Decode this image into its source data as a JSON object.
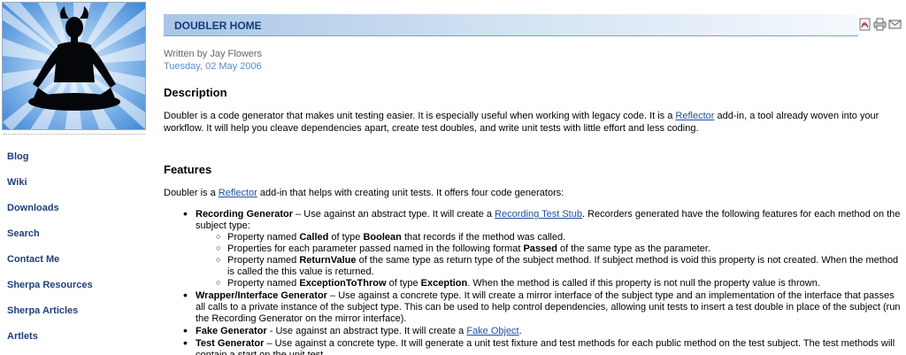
{
  "sidebar": {
    "nav": [
      {
        "label": "Blog"
      },
      {
        "label": "Wiki"
      },
      {
        "label": "Downloads"
      },
      {
        "label": "Search"
      },
      {
        "label": "Contact Me"
      },
      {
        "label": "Sherpa Resources"
      },
      {
        "label": "Sherpa Articles"
      },
      {
        "label": "Artlets"
      }
    ]
  },
  "article": {
    "title": "DOUBLER HOME",
    "written_by": "Written by Jay Flowers",
    "date": "Tuesday, 02 May 2006",
    "description_heading": "Description",
    "description": {
      "p1": "Doubler is a code generator that makes unit testing easier. It is especially useful when working with legacy code. It is a ",
      "link": "Reflector",
      "p2": " add-in, a tool already woven into your workflow. It will help you cleave dependencies apart, create test doubles, and write unit tests with little effort and less coding."
    },
    "features_heading": "Features",
    "features_intro": {
      "p1": "Doubler is a ",
      "link": "Reflector",
      "p2": " add-in that helps with creating unit tests. It offers four code generators:"
    },
    "features": [
      {
        "name": "Recording Generator",
        "t1": " – Use against an abstract type. It will create a ",
        "link": "Recording Test Stub",
        "t2": ". Recorders generated have the following features for each method on the subject type:",
        "sub": [
          {
            "a": "Property named ",
            "b1": "Called",
            "c": " of type ",
            "b2": "Boolean",
            "d": " that records if the method was called."
          },
          {
            "a": "Properties for each parameter passed named in the following format ",
            "b1": "Passed",
            "c": " of the same type as the parameter.",
            "b2": "",
            "d": ""
          },
          {
            "a": "Property named ",
            "b1": "ReturnValue",
            "c": " of the same type as return type of the subject method. If subject method is void this property is not created. When the method is called the this value is returned.",
            "b2": "",
            "d": ""
          },
          {
            "a": "Property named ",
            "b1": "ExceptionToThrow",
            "c": " of type ",
            "b2": "Exception",
            "d": ". When the method is called if this property is not null the property value is thrown."
          }
        ]
      },
      {
        "name": "Wrapper/Interface Generator",
        "t1": " – Use against a concrete type. It will create a mirror interface of the subject type and an implementation of the interface that passes all calls to a private instance of the subject type. This can be used to help control dependencies, allowing unit tests to insert a test double in place of the subject (run the Recording Generator on the mirror interface).",
        "link": "",
        "t2": ""
      },
      {
        "name": "Fake Generator",
        "t1": " - Use against an abstract type. It will create a ",
        "link": "Fake Object",
        "t2": "."
      },
      {
        "name": "Test Generator",
        "t1": " – Use against a concrete type. It will generate a unit test fixture and test methods for each public method on the test subject. The test methods will contain a start on the unit test.",
        "link": "",
        "t2": ""
      }
    ]
  },
  "icons": {
    "pdf": "pdf-icon",
    "print": "print-icon",
    "email": "email-icon"
  },
  "colors": {
    "nav_link": "#1f3f7a",
    "title_text": "#123d7a",
    "date": "#5a8cc8",
    "link": "#1f4f9a"
  }
}
